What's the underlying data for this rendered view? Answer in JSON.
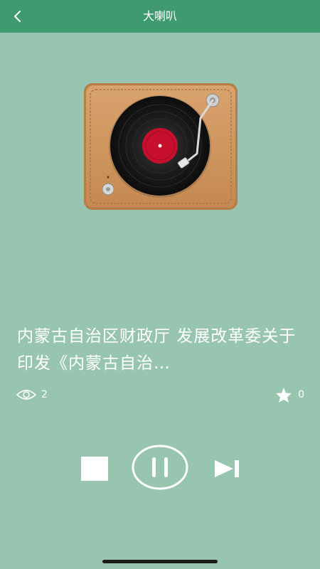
{
  "header": {
    "title": "大喇叭",
    "back_icon": "chevron-left-icon"
  },
  "article": {
    "title": "内蒙古自治区财政厅 发展改革委关于印发《内蒙古自治…"
  },
  "stats": {
    "views": "2",
    "views_icon": "eye-icon",
    "favorites": "0",
    "favorites_icon": "star-icon"
  },
  "player": {
    "stop_icon": "stop-icon",
    "pause_icon": "pause-icon",
    "next_icon": "skip-next-icon",
    "artwork_icon": "record-player-icon"
  },
  "colors": {
    "header_bg": "#3f9a70",
    "page_bg": "#97c5b0",
    "text": "#ffffff"
  }
}
